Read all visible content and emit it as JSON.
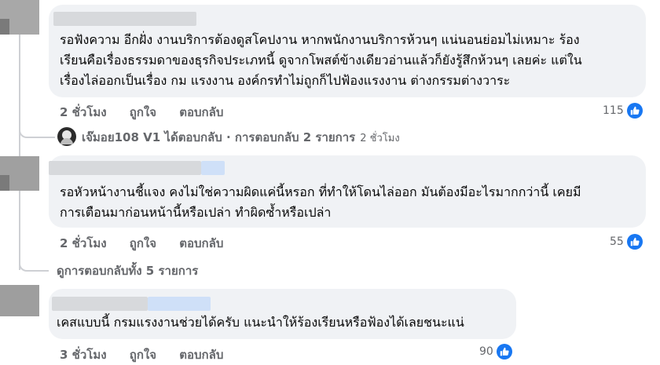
{
  "comments": [
    {
      "text_lines": [
        "รอฟังความ อีกฝั่ง งานบริการต้องดูสโคปงาน หากพนักงานบริการห้วนๆ แน่นอนย่อมไม่เหมาะ ร้อง",
        "เรียนคือเรื่องธรรมดาของธุรกิจประเภทนี้ ดูจากโพสต์ข้างเดียวอ่านแล้วก็ยังรู้สึกห้วนๆ เลยค่ะ แต่ใน",
        "เรื่องไล่ออกเป็นเรื่อง กม แรงงาน องค์กรทำไม่ถูกก็ไปฟ้องแรงงาน ต่างกรรมต่างวาระ"
      ],
      "time": "2 ชั่วโมง",
      "like_label": "ถูกใจ",
      "reply_label": "ตอบกลับ",
      "reaction_count": "115"
    },
    {
      "text_lines": [
        "รอหัวหน้างานชี้แจง คงไม่ใช่ความผิดแค่นี้หรอก ที่ทำให้โดนไล่ออก มันต้องมีอะไรมากกว่านี้ เคยมี",
        "การเตือนมาก่อนหน้านี้หรือเปล่า ทำผิดซ้ำหรือเปล่า"
      ],
      "time": "2 ชั่วโมง",
      "like_label": "ถูกใจ",
      "reply_label": "ตอบกลับ",
      "reaction_count": "55"
    },
    {
      "text_lines": [
        "เคสแบบนี้ กรมแรงงานช่วยได้ครับ แนะนำให้ร้องเรียนหรือฟ้องได้เลยชนะแน่"
      ],
      "time": "3 ชั่วโมง",
      "like_label": "ถูกใจ",
      "reply_label": "ตอบกลับ",
      "reaction_count": "90"
    }
  ],
  "reply_summary": {
    "text": "เจ๊มอย108 V1 ได้ตอบกลับ · การตอบกลับ 2 รายการ",
    "time": "2 ชั่วโมง"
  },
  "view_more_replies": "ดูการตอบกลับทั้ง 5 รายการ",
  "colors": {
    "bubble": "#f0f2f5",
    "like_blue": "#1877f2",
    "secondary_text": "#65676b"
  }
}
